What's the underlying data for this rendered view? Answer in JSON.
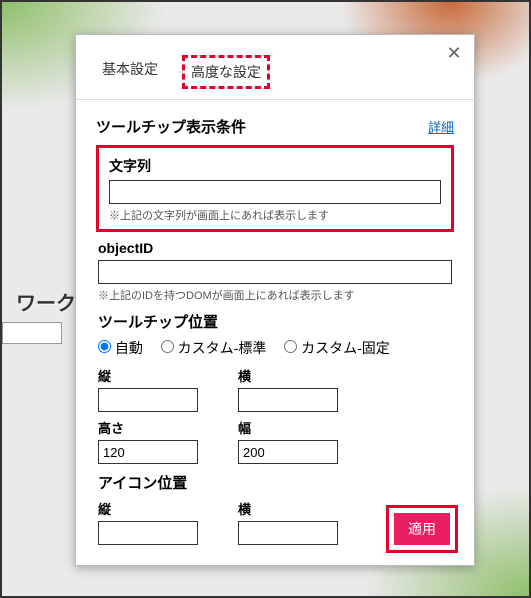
{
  "background": {
    "label": "ワーク"
  },
  "panel": {
    "tabs": {
      "basic": "基本設定",
      "advanced": "高度な設定"
    },
    "section1": {
      "title": "ツールチップ表示条件",
      "detail": "詳細"
    },
    "stringField": {
      "label": "文字列",
      "value": "",
      "hint": "※上記の文字列が画面上にあれば表示します"
    },
    "objectIdField": {
      "label": "objectID",
      "value": "",
      "hint": "※上記のIDを持つDOMが画面上にあれば表示します"
    },
    "position": {
      "title": "ツールチップ位置",
      "options": {
        "auto": "自動",
        "customStd": "カスタム-標準",
        "customFixed": "カスタム-固定"
      },
      "rows": {
        "vertical": "縦",
        "horizontal": "横",
        "height": "高さ",
        "width": "幅"
      },
      "values": {
        "vertical": "",
        "horizontal": "",
        "height": "120",
        "width": "200"
      }
    },
    "iconPos": {
      "title": "アイコン位置",
      "vertical": "縦",
      "horizontal": "横",
      "values": {
        "vertical": "",
        "horizontal": ""
      }
    },
    "apply": "適用"
  }
}
